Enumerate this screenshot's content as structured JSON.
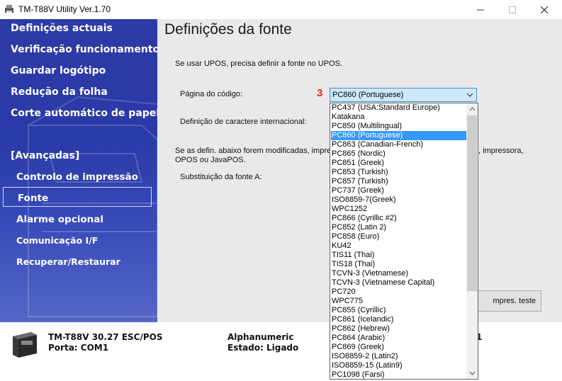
{
  "window": {
    "title": "TM-T88V Utility Ver.1.70"
  },
  "sidebar": {
    "items": [
      {
        "label": "Definições actuais"
      },
      {
        "label": "Verificação funcionamento"
      },
      {
        "label": "Guardar logótipo"
      },
      {
        "label": "Redução da folha"
      },
      {
        "label": "Corte automático de papel"
      },
      {
        "label": "[Avançadas]"
      },
      {
        "label": "Controlo de impressão"
      },
      {
        "label": "Fonte"
      },
      {
        "label": "Alarme opcional"
      },
      {
        "label": "Comunicação I/F"
      },
      {
        "label": "Recuperar/Restaurar"
      }
    ],
    "selected": "Fonte"
  },
  "main": {
    "title": "Definições da fonte",
    "intro": "Se usar UPOS, precisa definir a fonte no UPOS.",
    "codepage_label": "Página do código:",
    "step_marker": "3",
    "codepage_value": "PC860 (Portuguese)",
    "intl_label": "Definição de caractere internacional:",
    "note_line1": "Se as defin. abaixo forem modificadas, impres",
    "note_line1_right": ", impressora,",
    "note_line2": "OPOS ou JavaPOS.",
    "font_sub_label": "Substituição da fonte A:",
    "test_button": "mpres. teste"
  },
  "statusbar": {
    "model": "TM-T88V 30.27 ESC/POS",
    "port": "Porta: COM1",
    "mode": "Alphanumeric",
    "state": "Estado: Ligado",
    "right_char": "1"
  },
  "dropdown": {
    "selected_index": 3,
    "options": [
      "PC437 (USA:Standard Europe)",
      "Katakana",
      "PC850 (Multilingual)",
      "PC860 (Portuguese)",
      "PC863 (Canadian-French)",
      "PC865 (Nordic)",
      "PC851 (Greek)",
      "PC853 (Turkish)",
      "PC857 (Turkish)",
      "PC737 (Greek)",
      "ISO8859-7(Greek)",
      "WPC1252",
      "PC866 (Cyrillic #2)",
      "PC852 (Latin 2)",
      "PC858 (Euro)",
      "KU42",
      "TIS11 (Thai)",
      "TIS18 (Thai)",
      "TCVN-3 (Vietnamese)",
      "TCVN-3 (Vietnamese Capital)",
      "PC720",
      "WPC775",
      "PC855 (Cyrillic)",
      "PC861 (Icelandic)",
      "PC862 (Hebrew)",
      "PC864 (Arabic)",
      "PC869 (Greek)",
      "ISO8859-2 (Latin2)",
      "ISO8859-15 (Latin9)",
      "PC1098 (Farsi)"
    ]
  },
  "colors": {
    "sidebar_bg": "#2e3aa6",
    "main_bg": "#e9e9e9",
    "selection": "#3399ff",
    "combo_bg": "#cde8fb",
    "step_marker": "#e8231f"
  },
  "icons": {
    "app": "printer-icon",
    "minimize": "minimize-icon",
    "maximize": "maximize-icon",
    "close": "close-icon",
    "combo_arrow": "chevron-down-icon",
    "scroll_up": "scroll-up-icon",
    "scroll_down": "scroll-down-icon"
  }
}
